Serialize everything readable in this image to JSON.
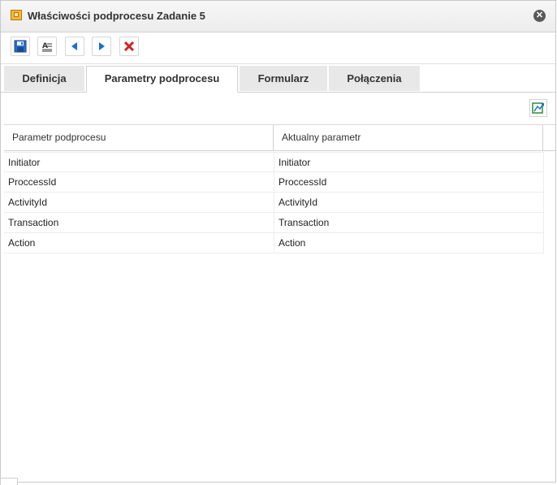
{
  "window": {
    "title": "Właściwości podprocesu Zadanie 5",
    "title_icon": "subprocess-icon",
    "close_icon": "close-icon"
  },
  "toolbar": {
    "buttons": [
      {
        "name": "save-button",
        "icon": "save-icon"
      },
      {
        "name": "format-button",
        "icon": "text-format-icon"
      },
      {
        "name": "previous-button",
        "icon": "arrow-left-icon"
      },
      {
        "name": "next-button",
        "icon": "arrow-right-icon"
      },
      {
        "name": "delete-button",
        "icon": "delete-icon"
      }
    ]
  },
  "tabs": [
    {
      "label": "Definicja",
      "active": false
    },
    {
      "label": "Parametry podprocesu",
      "active": true
    },
    {
      "label": "Formularz",
      "active": false
    },
    {
      "label": "Połączenia",
      "active": false
    }
  ],
  "grid": {
    "export_icon": "export-icon",
    "columns": [
      "Parametr podprocesu",
      "Aktualny parametr"
    ],
    "rows": [
      [
        "Initiator",
        "Initiator"
      ],
      [
        "ProccessId",
        "ProccessId"
      ],
      [
        "ActivityId",
        "ActivityId"
      ],
      [
        "Transaction",
        "Transaction"
      ],
      [
        "Action",
        "Action"
      ]
    ]
  },
  "colors": {
    "accent_blue": "#1a6fd0",
    "delete_red": "#d42020",
    "export_green": "#2e8b3a"
  }
}
